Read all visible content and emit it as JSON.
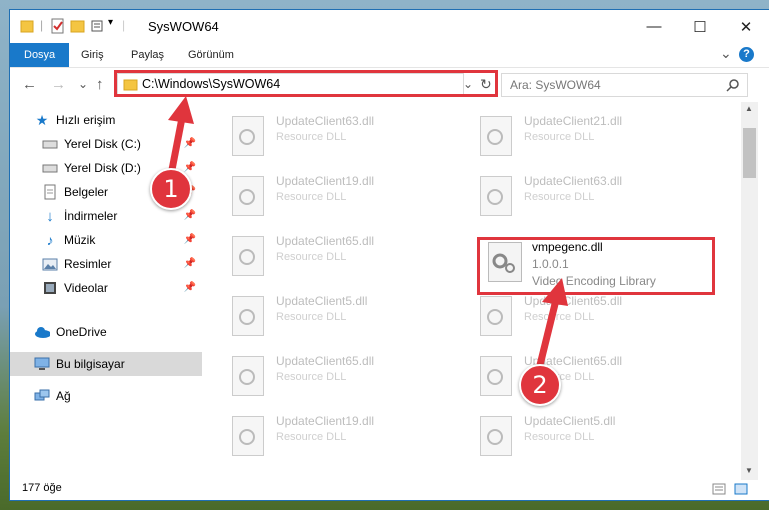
{
  "window": {
    "title": "SysWOW64",
    "min": "—",
    "max": "☐",
    "close": "✕"
  },
  "ribbon": {
    "tabs": [
      "Dosya",
      "Giriş",
      "Paylaş",
      "Görünüm"
    ],
    "collapse": "⌄",
    "help": "?"
  },
  "nav": {
    "back": "←",
    "forward": "→",
    "dropdown": "⌄",
    "up": "↑",
    "address": "C:\\Windows\\SysWOW64",
    "address_drop": "⌄",
    "refresh": "↻",
    "search_placeholder": "Ara: SysWOW64",
    "search_icon": "🔍"
  },
  "sidebar": {
    "quick_access": "Hızlı erişim",
    "items": [
      {
        "label": "Yerel Disk (C:)",
        "icon": "drive-icon"
      },
      {
        "label": "Yerel Disk (D:)",
        "icon": "drive-icon"
      },
      {
        "label": "Belgeler",
        "icon": "documents-icon"
      },
      {
        "label": "İndirmeler",
        "icon": "downloads-icon"
      },
      {
        "label": "Müzik",
        "icon": "music-icon"
      },
      {
        "label": "Resimler",
        "icon": "pictures-icon"
      },
      {
        "label": "Videolar",
        "icon": "videos-icon"
      }
    ],
    "onedrive": "OneDrive",
    "this_pc": "Bu bilgisayar",
    "network": "Ağ"
  },
  "files_left": [
    {
      "name": "UpdateClient63.dll",
      "desc": "Resource DLL"
    },
    {
      "name": "UpdateClient19.dll",
      "desc": "Resource DLL"
    },
    {
      "name": "UpdateClient65.dll",
      "desc": "Resource DLL"
    },
    {
      "name": "UpdateClient5.dll",
      "desc": "Resource DLL"
    },
    {
      "name": "UpdateClient65.dll",
      "desc": "Resource DLL"
    },
    {
      "name": "UpdateClient19.dll",
      "desc": "Resource DLL"
    }
  ],
  "files_right": [
    {
      "name": "UpdateClient21.dll",
      "desc": "Resource DLL"
    },
    {
      "name": "UpdateClient63.dll",
      "desc": "Resource DLL"
    },
    {
      "name": "UpdateClient65.dll",
      "desc": "Resource DLL"
    },
    {
      "name": "UpdateClient65.dll",
      "desc": "Resource DLL"
    },
    {
      "name": "UpdateClient5.dll",
      "desc": "Resource DLL"
    }
  ],
  "highlight_file": {
    "name": "vmpegenc.dll",
    "version": "1.0.0.1",
    "desc": "Video Encoding Library"
  },
  "status": {
    "count": "177 öğe"
  },
  "callouts": [
    "1",
    "2"
  ],
  "colors": {
    "accent": "#1979ca",
    "highlight": "#e0353d"
  }
}
